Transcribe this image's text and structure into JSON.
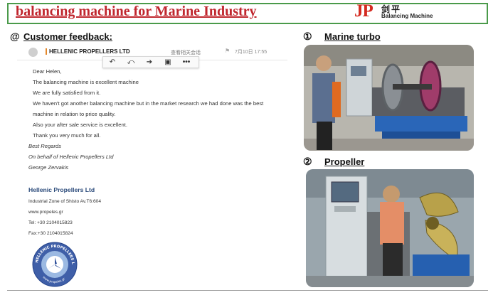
{
  "header": {
    "title": "balancing machine for Marine Industry",
    "logo_letters": "JP",
    "logo_chinese": "剑平",
    "logo_subtitle": "Balancing Machine"
  },
  "feedback": {
    "icon": "@",
    "title": "Customer feedback:"
  },
  "email": {
    "sender": "HELLENIC PROPELLERS LTD",
    "view_conversation": "查看相关会话",
    "date": "7月10日 17:55",
    "toolbar": [
      "reply-icon",
      "reply-all-icon",
      "forward-icon",
      "save-icon",
      "more-icon"
    ],
    "body": [
      "Dear Helen,",
      "The balancing machine is excellent machine",
      "We are fully satisfied from it.",
      "We haven't got another balancing machine but in the market research we had done was the best",
      "machine in relation to price quality.",
      "Also your after sale  service is excellent.",
      "Thank you very much for all."
    ],
    "signature": [
      "Best Regards",
      "On behalf of Hellenic Propellers Ltd",
      "George Zervakis"
    ],
    "company": "Hellenic Propellers Ltd",
    "contact": [
      "Industrial Zone of Shisto Av.T6:604",
      "www.propeles.gr",
      "Tel: +30 2104015823",
      "Fax:+30 2104015824"
    ],
    "seal_text": "HELLENIC PROPELLERS LTD",
    "seal_url": "www.propeles.gr"
  },
  "sections": [
    {
      "number": "①",
      "title": "Marine turbo"
    },
    {
      "number": "②",
      "title": "Propeller"
    }
  ],
  "colors": {
    "header_border": "#4a9a4a",
    "title_red": "#c0262e",
    "accent_orange": "#e4882b",
    "company_blue": "#2a4a7a"
  }
}
